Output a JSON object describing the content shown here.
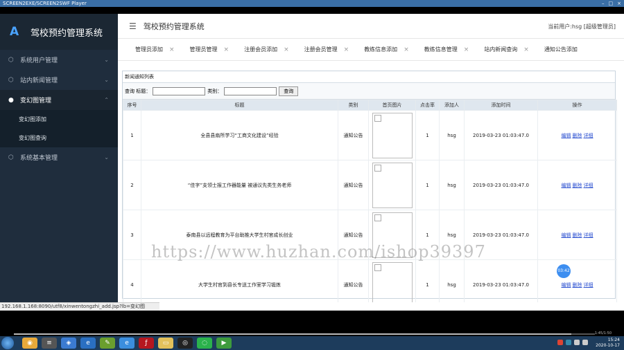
{
  "player": {
    "title": "SCREEN2EXE/SCREEN2SWF Player",
    "controls": [
      "–",
      "□",
      "×"
    ]
  },
  "sidebar": {
    "brand": "驾校预约管理系统",
    "items": [
      {
        "label": "系统用户管理",
        "icon": "cube-icon",
        "chevron": "⌄"
      },
      {
        "label": "站内新闻管理",
        "icon": "cube-icon",
        "chevron": "⌄"
      },
      {
        "label": "变幻图管理",
        "icon": "user-icon",
        "chevron": "⌃"
      },
      {
        "label": "系统基本管理",
        "icon": "cube-icon",
        "chevron": "⌄"
      }
    ],
    "sub_items": [
      {
        "label": "变幻图添加"
      },
      {
        "label": "变幻图查询"
      }
    ]
  },
  "topbar": {
    "title": "驾校预约管理系统",
    "user": "当前用户:hsg [超级管理员]",
    "menu_icon": "☰"
  },
  "tabs": [
    {
      "label": "管理员添加"
    },
    {
      "label": "管理员管理"
    },
    {
      "label": "注册会员添加"
    },
    {
      "label": "注册会员管理"
    },
    {
      "label": "教练信息添加"
    },
    {
      "label": "教练信息管理"
    },
    {
      "label": "站内新闻查询"
    },
    {
      "label": "通知公告添加"
    }
  ],
  "panel": {
    "heading": "新闻通知列表",
    "search": {
      "label_title": "查询 标题：",
      "label_cat": "类别：",
      "button": "查询",
      "title_value": "",
      "cat_value": ""
    }
  },
  "table": {
    "columns": [
      "序号",
      "标题",
      "类别",
      "首页图片",
      "点击率",
      "添加人",
      "添加时间",
      "操作"
    ],
    "rows": [
      {
        "no": "1",
        "title": "全县县扇所学习“工商文化建设”经验",
        "cat": "通知公告",
        "clicks": "1",
        "by": "hsg",
        "time": "2019-03-23 01:03:47.0"
      },
      {
        "no": "2",
        "title": "“佳字”支领士报工作器能量 被通议先类生务老师",
        "cat": "通知公告",
        "clicks": "1",
        "by": "hsg",
        "time": "2019-03-23 01:03:47.0"
      },
      {
        "no": "3",
        "title": "泰南县以远程教育为平台助推大学生村官成长创业",
        "cat": "通知公告",
        "clicks": "1",
        "by": "hsg",
        "time": "2019-03-23 01:03:47.0"
      },
      {
        "no": "4",
        "title": "大学生村官到县长专送工作室学习锻炼",
        "cat": "通知公告",
        "clicks": "1",
        "by": "hsg",
        "time": "2019-03-23 01:03:47.0"
      }
    ],
    "ops": [
      "编辑",
      "删除",
      "详细"
    ]
  },
  "watermark": "https://www.huzhan.com/ishop39397",
  "timer_badge": "03:42",
  "statusbar": "192.168.1.168:8090/utf8/xinwentongzhi_add.jsp?lb=变幻图",
  "progress": {
    "fraction": 0.96,
    "time": "1:45/1:50"
  },
  "clock": {
    "time": "15:24",
    "date": "2020-10-17"
  },
  "colors": {
    "sidebar": "#1f2d3d",
    "accent": "#4aa3ff",
    "link": "#2a4fd0",
    "header_row": "#dfe7ef"
  }
}
